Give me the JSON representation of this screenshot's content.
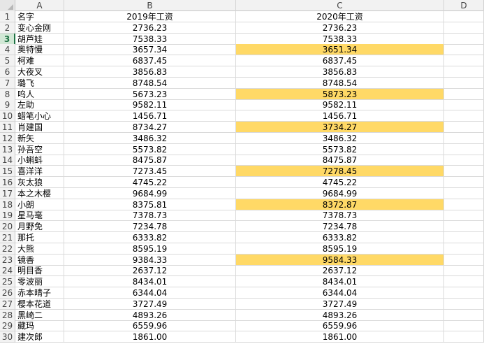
{
  "columns": [
    "A",
    "B",
    "C",
    "D"
  ],
  "header": {
    "name": "名字",
    "y2019": "2019年工资",
    "y2020": "2020年工资"
  },
  "active_row": 3,
  "highlight_color": "#ffd966",
  "rows": [
    {
      "n": "2",
      "name": "变心金刚",
      "v2019": "2736.23",
      "v2020": "2736.23",
      "hl": false
    },
    {
      "n": "3",
      "name": "胡芦娃",
      "v2019": "7538.33",
      "v2020": "7538.33",
      "hl": false
    },
    {
      "n": "4",
      "name": "奥特慢",
      "v2019": "3657.34",
      "v2020": "3651.34",
      "hl": true
    },
    {
      "n": "5",
      "name": "柯难",
      "v2019": "6837.45",
      "v2020": "6837.45",
      "hl": false
    },
    {
      "n": "6",
      "name": "大夜叉",
      "v2019": "3856.83",
      "v2020": "3856.83",
      "hl": false
    },
    {
      "n": "7",
      "name": "璐飞",
      "v2019": "8748.54",
      "v2020": "8748.54",
      "hl": false
    },
    {
      "n": "8",
      "name": "呜人",
      "v2019": "5673.23",
      "v2020": "5873.23",
      "hl": true
    },
    {
      "n": "9",
      "name": "左助",
      "v2019": "9582.11",
      "v2020": "9582.11",
      "hl": false
    },
    {
      "n": "10",
      "name": "蜡笔小心",
      "v2019": "1456.71",
      "v2020": "1456.71",
      "hl": false
    },
    {
      "n": "11",
      "name": "肖建国",
      "v2019": "8734.27",
      "v2020": "3734.27",
      "hl": true
    },
    {
      "n": "12",
      "name": "新矢",
      "v2019": "3486.32",
      "v2020": "3486.32",
      "hl": false
    },
    {
      "n": "13",
      "name": "孙吾空",
      "v2019": "5573.82",
      "v2020": "5573.82",
      "hl": false
    },
    {
      "n": "14",
      "name": "小蝌蚪",
      "v2019": "8475.87",
      "v2020": "8475.87",
      "hl": false
    },
    {
      "n": "15",
      "name": "喜洋洋",
      "v2019": "7273.45",
      "v2020": "7278.45",
      "hl": true
    },
    {
      "n": "16",
      "name": "灰太狼",
      "v2019": "4745.22",
      "v2020": "4745.22",
      "hl": false
    },
    {
      "n": "17",
      "name": "本之木樱",
      "v2019": "9684.99",
      "v2020": "9684.99",
      "hl": false
    },
    {
      "n": "18",
      "name": "小朗",
      "v2019": "8375.81",
      "v2020": "8372.87",
      "hl": true
    },
    {
      "n": "19",
      "name": "星马毫",
      "v2019": "7378.73",
      "v2020": "7378.73",
      "hl": false
    },
    {
      "n": "20",
      "name": "月野免",
      "v2019": "7234.78",
      "v2020": "7234.78",
      "hl": false
    },
    {
      "n": "21",
      "name": "那托",
      "v2019": "6333.82",
      "v2020": "6333.82",
      "hl": false
    },
    {
      "n": "22",
      "name": "大熊",
      "v2019": "8595.19",
      "v2020": "8595.19",
      "hl": false
    },
    {
      "n": "23",
      "name": "镜香",
      "v2019": "9384.33",
      "v2020": "9584.33",
      "hl": true
    },
    {
      "n": "24",
      "name": "明目香",
      "v2019": "2637.12",
      "v2020": "2637.12",
      "hl": false
    },
    {
      "n": "25",
      "name": "零波丽",
      "v2019": "8434.01",
      "v2020": "8434.01",
      "hl": false
    },
    {
      "n": "26",
      "name": "赤本晴子",
      "v2019": "6344.04",
      "v2020": "6344.04",
      "hl": false
    },
    {
      "n": "27",
      "name": "樱本花道",
      "v2019": "3727.49",
      "v2020": "3727.49",
      "hl": false
    },
    {
      "n": "28",
      "name": "黑崎二",
      "v2019": "4893.26",
      "v2020": "4893.26",
      "hl": false
    },
    {
      "n": "29",
      "name": "藏玛",
      "v2019": "6559.96",
      "v2020": "6559.96",
      "hl": false
    },
    {
      "n": "30",
      "name": "建次郎",
      "v2019": "1861.00",
      "v2020": "1861.00",
      "hl": false
    }
  ]
}
